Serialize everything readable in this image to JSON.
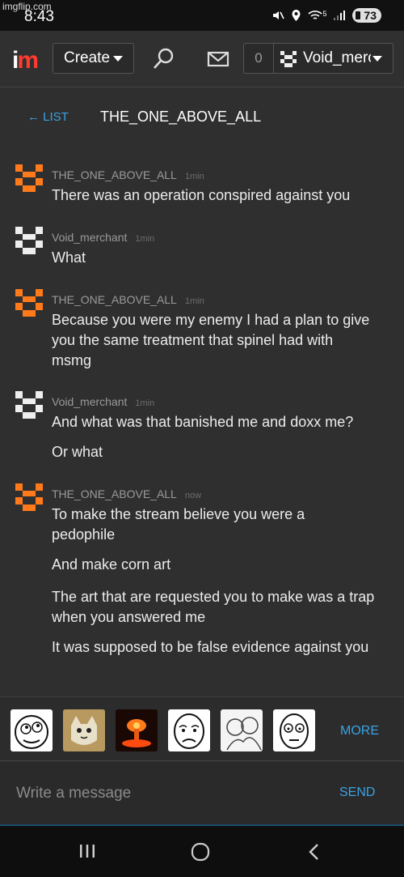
{
  "status_bar": {
    "watermark": "imgflip.com",
    "time": "8:43",
    "network": "5",
    "battery": "73"
  },
  "nav": {
    "logo_i": "i",
    "logo_m": "m",
    "create_label": "Create",
    "notification_count": "0",
    "username": "Void_merchant"
  },
  "thread": {
    "back_label": "← LIST",
    "title": "THE_ONE_ABOVE_ALL"
  },
  "messages": [
    {
      "author": "THE_ONE_ABOVE_ALL",
      "time": "1min",
      "avatar": "orange-pixel-avatar",
      "lines": [
        "There was an operation conspired against you"
      ]
    },
    {
      "author": "Void_merchant",
      "time": "1min",
      "avatar": "white-pixel-avatar",
      "lines": [
        "What"
      ]
    },
    {
      "author": "THE_ONE_ABOVE_ALL",
      "time": "1min",
      "avatar": "orange-pixel-avatar",
      "lines": [
        "Because you were my enemy I had a plan to give you the same treatment that spinel had with msmg"
      ]
    },
    {
      "author": "Void_merchant",
      "time": "1min",
      "avatar": "white-pixel-avatar",
      "lines": [
        "And what was that banished me and doxx me?",
        "Or what"
      ]
    },
    {
      "author": "THE_ONE_ABOVE_ALL",
      "time": "now",
      "avatar": "orange-pixel-avatar",
      "lines": [
        "To make the stream believe you were a pedophile",
        "And make corn art",
        "The art that are requested you to make was a trap when you answered me",
        "It was supposed to be false evidence against you"
      ]
    }
  ],
  "meme_bar": {
    "items": [
      "rage-face-meme",
      "cat-meme",
      "explosion-meme",
      "sad-face-meme",
      "hug-meme",
      "worried-face-meme"
    ],
    "more_label": "MORE"
  },
  "composer": {
    "placeholder": "Write a message",
    "send_label": "SEND"
  },
  "colors": {
    "accent": "#3aa3e3",
    "orange_avatar": "#ff7a1a",
    "background": "#2f2f2f"
  }
}
